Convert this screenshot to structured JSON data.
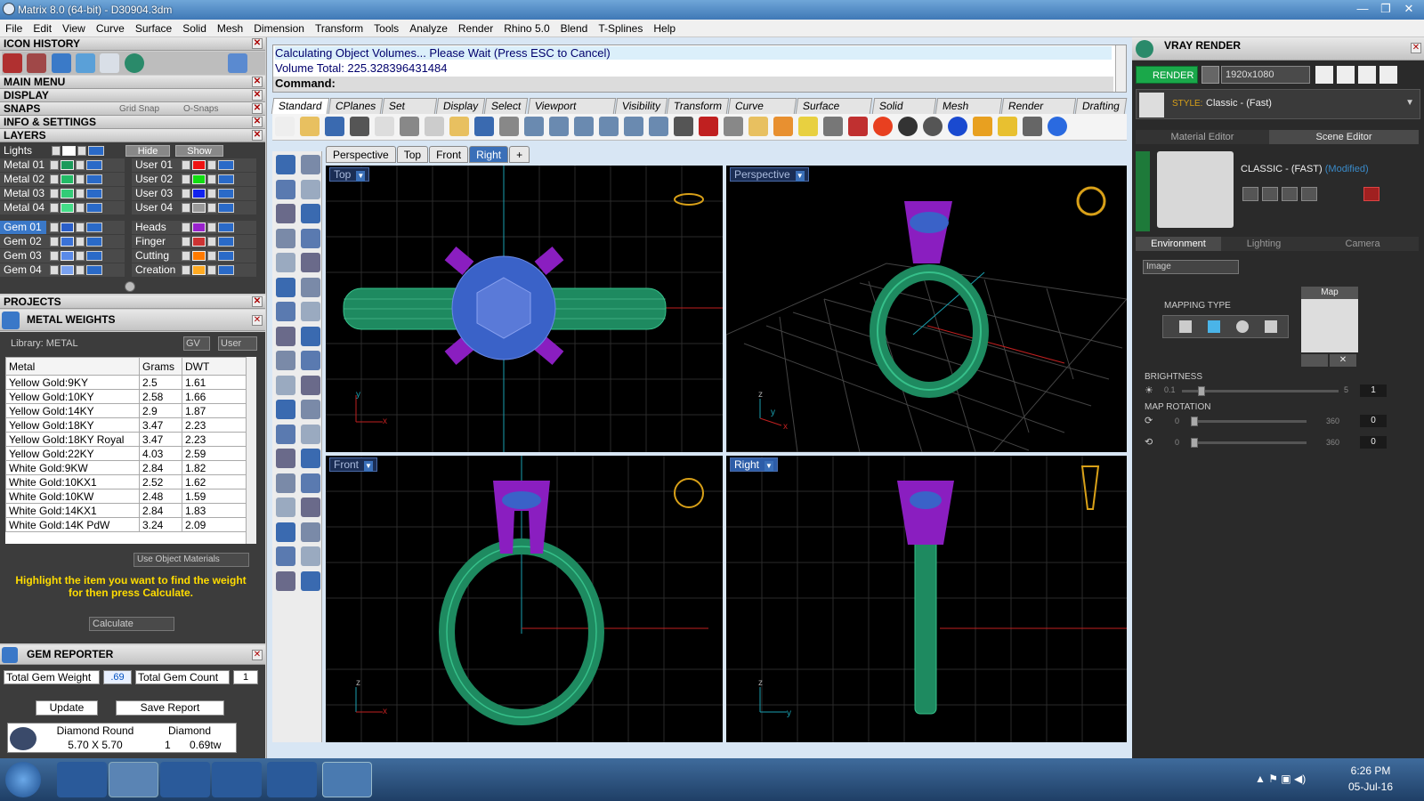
{
  "window": {
    "title": "Matrix 8.0 (64-bit) - D30904.3dm",
    "controls": [
      "—",
      "❐",
      "✕"
    ]
  },
  "menu": [
    "File",
    "Edit",
    "View",
    "Curve",
    "Surface",
    "Solid",
    "Mesh",
    "Dimension",
    "Transform",
    "Tools",
    "Analyze",
    "Render",
    "Rhino 5.0",
    "Blend",
    "T-Splines",
    "Help"
  ],
  "left": {
    "icon_history": "ICON HISTORY",
    "main_menu": "MAIN MENU",
    "display": "DISPLAY",
    "snaps": "SNAPS",
    "grid_snap": "Grid Snap",
    "o_snaps": "O-Snaps",
    "info_settings": "INFO & SETTINGS",
    "layers": "LAYERS",
    "lights": "Lights",
    "hide": "Hide",
    "show": "Show",
    "layers_left": [
      {
        "name": "Metal 01",
        "color": "#1a9a5a"
      },
      {
        "name": "Metal 02",
        "color": "#22bb66"
      },
      {
        "name": "Metal 03",
        "color": "#33cc77"
      },
      {
        "name": "Metal 04",
        "color": "#44dd88"
      },
      {
        "name": "Gem 01",
        "color": "#2a5ec8"
      },
      {
        "name": "Gem 02",
        "color": "#3a72d8"
      },
      {
        "name": "Gem 03",
        "color": "#5a8ae8"
      },
      {
        "name": "Gem 04",
        "color": "#7aa2f0"
      }
    ],
    "layers_right": [
      {
        "name": "User 01",
        "color": "#ee1111"
      },
      {
        "name": "User 02",
        "color": "#11dd11"
      },
      {
        "name": "User 03",
        "color": "#1122ee"
      },
      {
        "name": "User 04",
        "color": "#999999"
      },
      {
        "name": "Heads",
        "color": "#9922cc"
      },
      {
        "name": "Finger",
        "color": "#cc3333"
      },
      {
        "name": "Cutting",
        "color": "#ff7a00"
      },
      {
        "name": "Creation",
        "color": "#ffaa22"
      }
    ],
    "projects": "PROJECTS",
    "metal_weights": "METAL WEIGHTS",
    "library": "Library: METAL",
    "gv": "GV",
    "user": "User",
    "table_headers": [
      "Metal",
      "Grams",
      "DWT"
    ],
    "table_rows": [
      [
        "Yellow Gold:9KY",
        "2.5",
        "1.61"
      ],
      [
        "Yellow Gold:10KY",
        "2.58",
        "1.66"
      ],
      [
        "Yellow Gold:14KY",
        "2.9",
        "1.87"
      ],
      [
        "Yellow Gold:18KY",
        "3.47",
        "2.23"
      ],
      [
        "Yellow Gold:18KY Royal",
        "3.47",
        "2.23"
      ],
      [
        "Yellow Gold:22KY",
        "4.03",
        "2.59"
      ],
      [
        "White Gold:9KW",
        "2.84",
        "1.82"
      ],
      [
        "White Gold:10KX1",
        "2.52",
        "1.62"
      ],
      [
        "White Gold:10KW",
        "2.48",
        "1.59"
      ],
      [
        "White Gold:14KX1",
        "2.84",
        "1.83"
      ],
      [
        "White Gold:14K PdW",
        "3.24",
        "2.09"
      ]
    ],
    "use_object_materials": "Use Object Materials",
    "hint": "Highlight the item you want to find the weight for then press Calculate.",
    "calculate": "Calculate",
    "gem_reporter": "GEM REPORTER",
    "total_gem_weight_label": "Total Gem Weight",
    "total_gem_weight": ".69",
    "total_gem_count_label": "Total Gem Count",
    "total_gem_count": "1",
    "update": "Update",
    "save_report": "Save Report",
    "gem_row": {
      "shape": "Diamond Round",
      "size": "5.70 X 5.70",
      "type": "Diamond",
      "count": "1",
      "weight": "0.69tw"
    }
  },
  "command": {
    "line1": "Calculating Object Volumes... Please Wait (Press ESC to Cancel)",
    "line2": "Volume Total: 225.328396431484",
    "prompt": "Command:"
  },
  "toolbar_tabs": [
    "Standard",
    "CPlanes",
    "Set View",
    "Display",
    "Select",
    "Viewport Layout",
    "Visibility",
    "Transform",
    "Curve Tools",
    "Surface Tools",
    "Solid Tools",
    "Mesh Tools",
    "Render Tools",
    "Drafting"
  ],
  "viewport_tabs": [
    "Perspective",
    "Top",
    "Front",
    "Right"
  ],
  "viewports": {
    "top": "Top",
    "perspective": "Perspective",
    "front": "Front",
    "right": "Right"
  },
  "right": {
    "vray_render": "VRAY RENDER",
    "render": "RENDER",
    "resolution": "1920x1080",
    "style_label": "STYLE:",
    "style": "Classic - (Fast)",
    "material_editor": "Material Editor",
    "scene_editor": "Scene Editor",
    "scene_name": "CLASSIC - (FAST)",
    "modified": "(Modified)",
    "tabs": [
      "Environment",
      "Lighting",
      "Camera"
    ],
    "env_select": "Image",
    "mapping_type": "MAPPING TYPE",
    "map": "Map",
    "brightness": "BRIGHTNESS",
    "brightness_min": "0.1",
    "brightness_max": "5",
    "brightness_val": "1",
    "brightness_level": 0.1,
    "map_rotation": "MAP ROTATION",
    "rot1_min": "0",
    "rot1_max": "360",
    "rot1_val": "0",
    "rot2_min": "0",
    "rot2_max": "360",
    "rot2_val": "0"
  },
  "taskbar": {
    "time": "6:26 PM",
    "date": "05-Jul-16"
  }
}
